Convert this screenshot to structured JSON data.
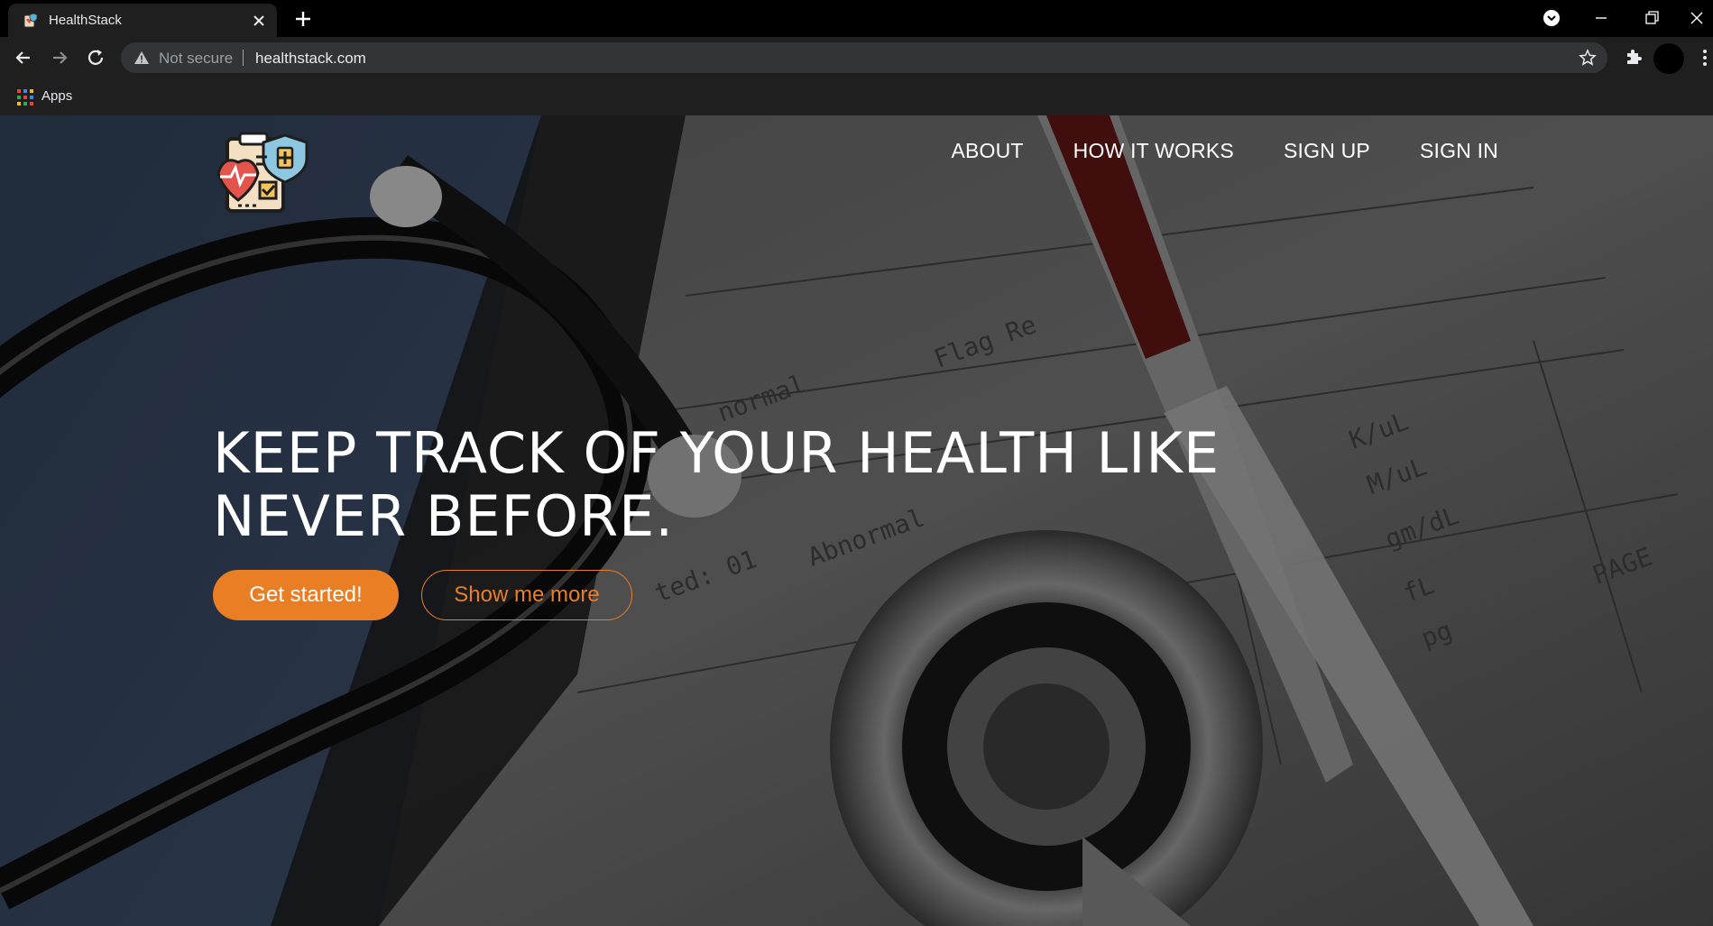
{
  "browser": {
    "tab_title": "HealthStack",
    "address_security": "Not secure",
    "url": "healthstack.com",
    "bookmarks_apps_label": "Apps"
  },
  "site": {
    "nav": {
      "about": "ABOUT",
      "how_it_works": "HOW IT WORKS",
      "sign_up": "SIGN UP",
      "sign_in": "SIGN IN"
    },
    "hero": {
      "headline": "KEEP TRACK OF YOUR HEALTH LIKE NEVER BEFORE.",
      "primary_cta": "Get started!",
      "secondary_cta": "Show me more"
    }
  },
  "colors": {
    "accent": "#e97e24",
    "chrome_bg": "#1f1f1f",
    "titlebar_bg": "#000000"
  },
  "icons": [
    "health-logo-icon",
    "back-icon",
    "forward-icon",
    "reload-icon",
    "warning-icon",
    "star-icon",
    "extensions-icon",
    "menu-icon",
    "apps-grid-icon",
    "close-icon",
    "plus-icon",
    "minimize-icon",
    "restore-icon"
  ]
}
